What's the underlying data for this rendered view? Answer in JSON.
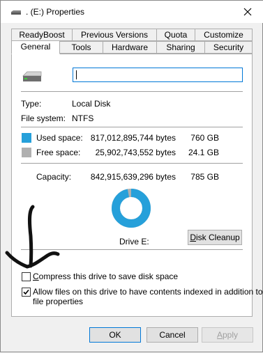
{
  "window": {
    "title": ". (E:) Properties",
    "close_icon": "close-icon",
    "drive_icon": "drive-icon"
  },
  "tabs_row1": [
    {
      "label": "ReadyBoost"
    },
    {
      "label": "Previous Versions"
    },
    {
      "label": "Quota"
    },
    {
      "label": "Customize"
    }
  ],
  "tabs_row2": [
    {
      "label": "General",
      "active": true
    },
    {
      "label": "Tools"
    },
    {
      "label": "Hardware"
    },
    {
      "label": "Sharing"
    },
    {
      "label": "Security"
    }
  ],
  "general": {
    "name_value": "",
    "type_label": "Type:",
    "type_value": "Local Disk",
    "fs_label": "File system:",
    "fs_value": "NTFS",
    "used_label": "Used space:",
    "used_bytes": "817,012,895,744 bytes",
    "used_size": "760 GB",
    "free_label": "Free space:",
    "free_bytes": "25,902,743,552 bytes",
    "free_size": "24.1 GB",
    "capacity_label": "Capacity:",
    "capacity_bytes": "842,915,639,296 bytes",
    "capacity_size": "785 GB",
    "drive_label": "Drive E:",
    "disk_cleanup": "Disk Cleanup",
    "compress_label": "Compress this drive to save disk space",
    "compress_checked": false,
    "index_label_line1": "Allow files on this drive to have contents indexed in addition to",
    "index_label_line2": "file properties",
    "index_checked": true,
    "used_color": "#26a0da",
    "free_color": "#b0b0b0",
    "used_fraction": 0.969
  },
  "buttons": {
    "ok": "OK",
    "cancel": "Cancel",
    "apply": "Apply"
  }
}
